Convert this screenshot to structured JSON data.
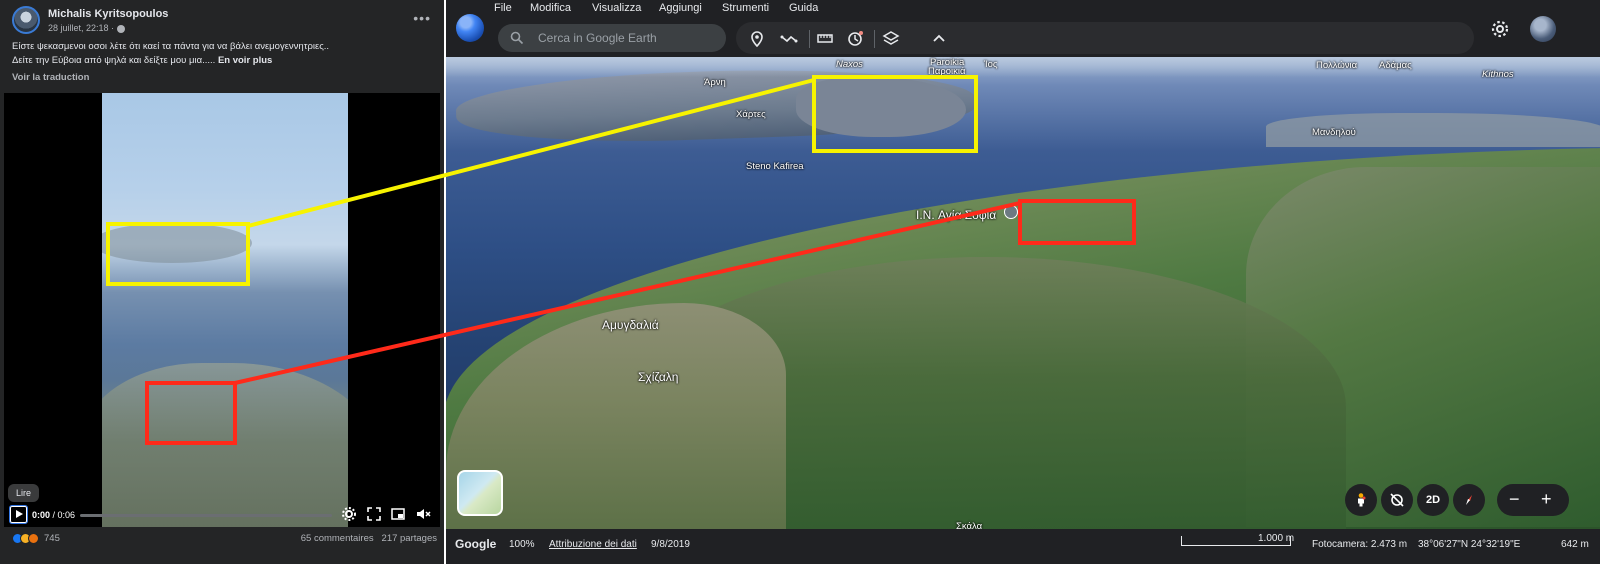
{
  "facebook": {
    "author": "Michalis Kyritsopoulos",
    "meta": "28 juillet, 22:18 · ",
    "post_line1": "Είστε ψεκασμενοι οσοι λέτε ότι καεί τα πάντα για να βάλει ανεμογεννητριες..",
    "post_line2": "Δείτε την Εύβοια από ψηλά και δείξτε μου μια..... ",
    "see_more": "En voir plus",
    "translate": "Voir la traduction",
    "tooltip": "Lire",
    "time_current": "0:00",
    "time_total": " / 0:06",
    "progress": 0,
    "reactions_count": "745",
    "comments": "65 commentaires",
    "shares": "217 partages",
    "icons": [
      "globe-icon",
      "more-icon",
      "play-icon",
      "settings-icon",
      "expand-icon",
      "pip-icon",
      "mute-icon",
      "like-icon",
      "care-icon",
      "angry-icon"
    ]
  },
  "earth": {
    "menu": [
      "File",
      "Modifica",
      "Visualizza",
      "Aggiungi",
      "Strumenti",
      "Guida"
    ],
    "search_placeholder": "Cerca in Google Earth",
    "labels": {
      "naxos": "Naxos",
      "paroikia": "Paroikia",
      "paroikia_gr": "Παροικιά",
      "ios": "Ίος",
      "pollonia": "Πολλώνια",
      "adamas": "Αδάμας",
      "kithnos": "Kithnos",
      "arni": "Άρνη",
      "chartes": "Χάρτες",
      "steno": "Steno Kafirea",
      "mandilou": "Μανδηλού",
      "agia_sofia": "I.N. Αγία Σοφία",
      "amygdalia": "Αμυγδαλιά",
      "schizali": "Σχίζαλη",
      "bottom": "Σκάλα"
    },
    "map_buttons": {
      "two_d": "2D"
    },
    "status": {
      "google": "Google",
      "zoom": "100%",
      "attribution": "Attribuzione dei dati",
      "date": "9/8/2019",
      "scale": "1.000 m",
      "camera": "Fotocamera: 2.473 m",
      "coords": "38°06'27\"N 24°32'19\"E",
      "elevation": "642 m"
    },
    "icons": [
      "search-icon",
      "placemark-icon",
      "path-icon",
      "ruler-icon",
      "history-icon",
      "layers-icon",
      "chevron-up-icon",
      "settings-icon",
      "pegman-icon",
      "tilt-icon",
      "compass-icon",
      "zoom-out-icon",
      "zoom-in-icon"
    ]
  },
  "annotations": {
    "colors": {
      "yellow": "#f7f300",
      "red": "#ff2a1a"
    }
  }
}
